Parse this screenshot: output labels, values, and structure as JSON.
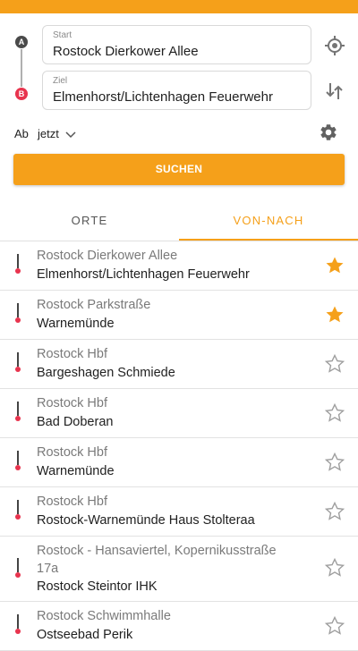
{
  "form": {
    "start_label": "Start",
    "start_value": "Rostock Dierkower Allee",
    "ziel_label": "Ziel",
    "ziel_value": "Elmenhorst/Lichtenhagen Feuerwehr",
    "marker_a": "A",
    "marker_b": "B",
    "ab_label": "Ab",
    "time_value": "jetzt",
    "search_label": "SUCHEN"
  },
  "tabs": [
    {
      "label": "ORTE",
      "active": false
    },
    {
      "label": "VON-NACH",
      "active": true
    }
  ],
  "routes": [
    {
      "from": "Rostock Dierkower Allee",
      "to": "Elmenhorst/Lichtenhagen Feuerwehr",
      "favorite": true
    },
    {
      "from": "Rostock Parkstraße",
      "to": "Warnemünde",
      "favorite": true
    },
    {
      "from": "Rostock Hbf",
      "to": "Bargeshagen Schmiede",
      "favorite": false
    },
    {
      "from": "Rostock Hbf",
      "to": "Bad Doberan",
      "favorite": false
    },
    {
      "from": "Rostock Hbf",
      "to": "Warnemünde",
      "favorite": false
    },
    {
      "from": "Rostock Hbf",
      "to": "Rostock-Warnemünde Haus Stolteraa",
      "favorite": false
    },
    {
      "from": "Rostock - Hansaviertel, Kopernikusstraße",
      "from2": "17a",
      "to": "Rostock Steintor IHK",
      "favorite": false
    },
    {
      "from": "Rostock Schwimmhalle",
      "to": "Ostseebad Perik",
      "favorite": false
    }
  ],
  "colors": {
    "accent": "#F5A01A",
    "marker_a": "#4a4a4a",
    "marker_b": "#E8344E",
    "star_filled": "#F5A01A",
    "star_outline": "#9e9e9e"
  },
  "icons": {
    "location": "crosshair-location-icon",
    "swap": "swap-vertical-icon",
    "settings": "gear-icon",
    "dropdown": "chevron-down-icon",
    "favorite": "star-icon"
  }
}
